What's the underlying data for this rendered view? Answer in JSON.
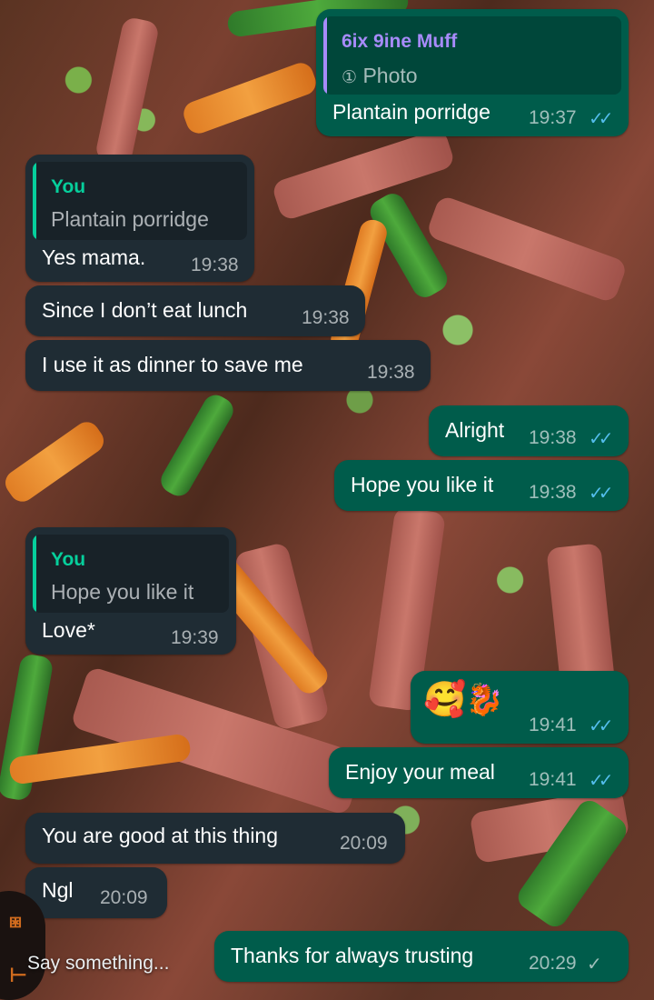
{
  "messages": [
    {
      "quote_name": "6ix 9ine Muff",
      "quote_text": "Photo",
      "text": "Plantain porridge",
      "time": "19:37",
      "ticks": "✓✓"
    },
    {
      "quote_name": "You",
      "quote_text": "Plantain porridge",
      "text": "Yes mama.",
      "time": "19:38"
    },
    {
      "text": "Since I don’t eat lunch",
      "time": "19:38"
    },
    {
      "text": "I use it as dinner to save me",
      "time": "19:38"
    },
    {
      "text": "Alright",
      "time": "19:38",
      "ticks": "✓✓"
    },
    {
      "text": "Hope you like it",
      "time": "19:38",
      "ticks": "✓✓"
    },
    {
      "quote_name": "You",
      "quote_text": "Hope you like it",
      "text": "Love*",
      "time": "19:39"
    },
    {
      "emoji": "🥰",
      "emoji2": "🐉",
      "time": "19:41",
      "ticks": "✓✓"
    },
    {
      "text": "Enjoy your meal",
      "time": "19:41",
      "ticks": "✓✓"
    },
    {
      "text": "You are good at this thing",
      "time": "20:09"
    },
    {
      "text": "Ngl",
      "time": "20:09"
    },
    {
      "text": "Thanks for always trusting",
      "time": "20:29",
      "ticks": "✓"
    }
  ],
  "photo_icon": "①",
  "input": {
    "placeholder": "Say something..."
  },
  "colors": {
    "incoming_bubble": "#1f2c34",
    "outgoing_bubble": "#005c4b",
    "read_ticks": "#53bdeb",
    "quote_name_contact": "#a78bfa",
    "quote_name_you": "#06cf9c"
  }
}
